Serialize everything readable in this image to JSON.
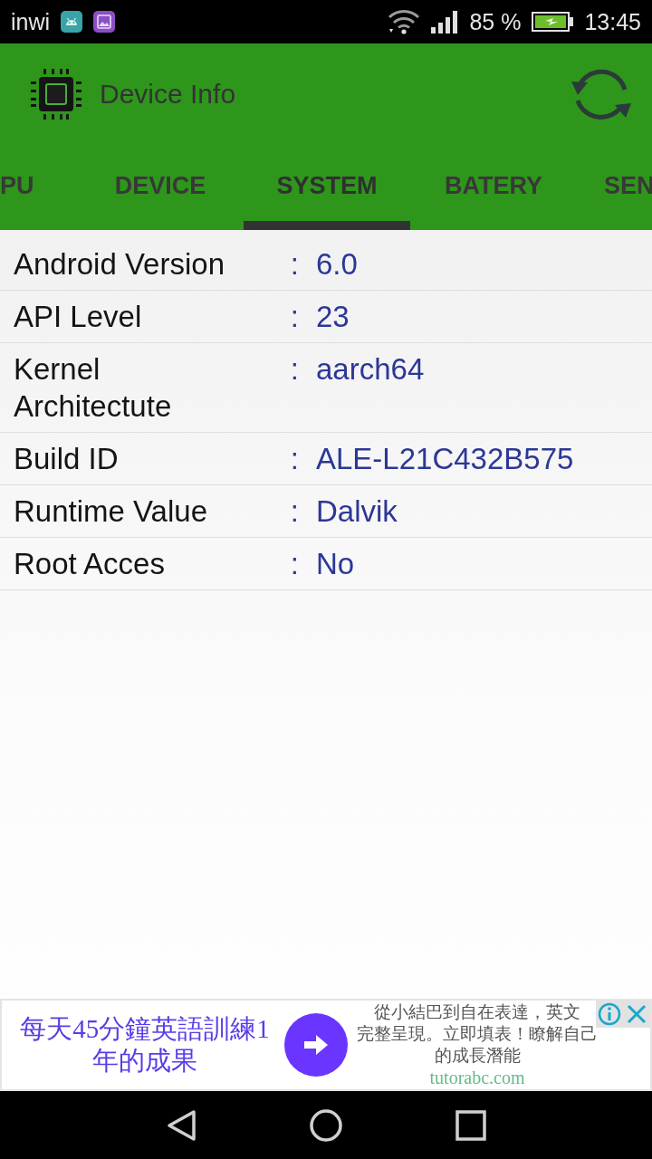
{
  "status_bar": {
    "carrier": "inwi",
    "battery_percent": "85 %",
    "time": "13:45"
  },
  "app_bar": {
    "title": "Device Info"
  },
  "tabs": [
    {
      "label": "PU",
      "selected": false
    },
    {
      "label": "DEVICE",
      "selected": false
    },
    {
      "label": "SYSTEM",
      "selected": true
    },
    {
      "label": "BATERY",
      "selected": false
    },
    {
      "label": "SEN",
      "selected": false
    }
  ],
  "info_rows": [
    {
      "label": "Android Version",
      "separator": ":",
      "value": "6.0"
    },
    {
      "label": "API Level",
      "separator": ":",
      "value": "23"
    },
    {
      "label": "Kernel Architectute",
      "separator": ":",
      "value": "aarch64"
    },
    {
      "label": "Build ID",
      "separator": ":",
      "value": "ALE-L21C432B575"
    },
    {
      "label": "Runtime Value",
      "separator": ":",
      "value": "Dalvik"
    },
    {
      "label": "Root Acces",
      "separator": ":",
      "value": "No"
    }
  ],
  "ad": {
    "headline_lines": [
      "每天45分鐘英語訓練1",
      "年的成果"
    ],
    "description_lines": [
      "從小結巴到自在表達，英文",
      "完整呈現。立即填表！瞭解自己",
      "的成長潛能"
    ],
    "domain": "tutorabc.com"
  }
}
